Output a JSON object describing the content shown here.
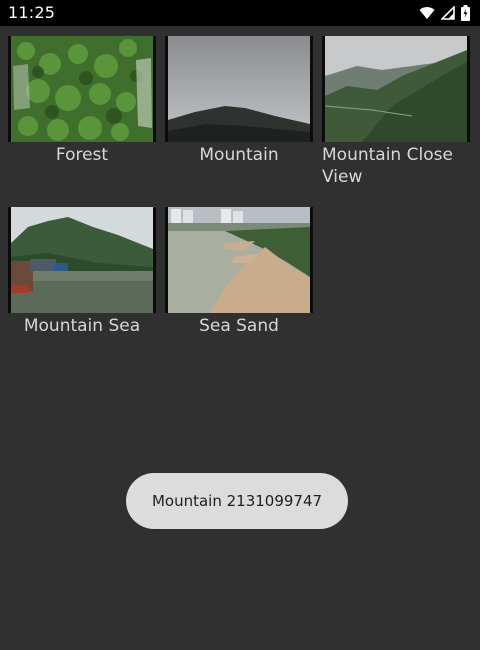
{
  "status_bar": {
    "time": "11:25",
    "icons": [
      "wifi-icon",
      "cell-signal-icon",
      "battery-icon"
    ]
  },
  "gallery": {
    "items": [
      {
        "label": "Forest",
        "image": "forest"
      },
      {
        "label": "Mountain",
        "image": "mountain"
      },
      {
        "label": "Mountain Close View",
        "image": "mountain-close-view"
      },
      {
        "label": "Mountain Sea",
        "image": "mountain-sea"
      },
      {
        "label": "Sea Sand",
        "image": "sea-sand"
      }
    ]
  },
  "toast": {
    "text": "Mountain 2131099747"
  }
}
